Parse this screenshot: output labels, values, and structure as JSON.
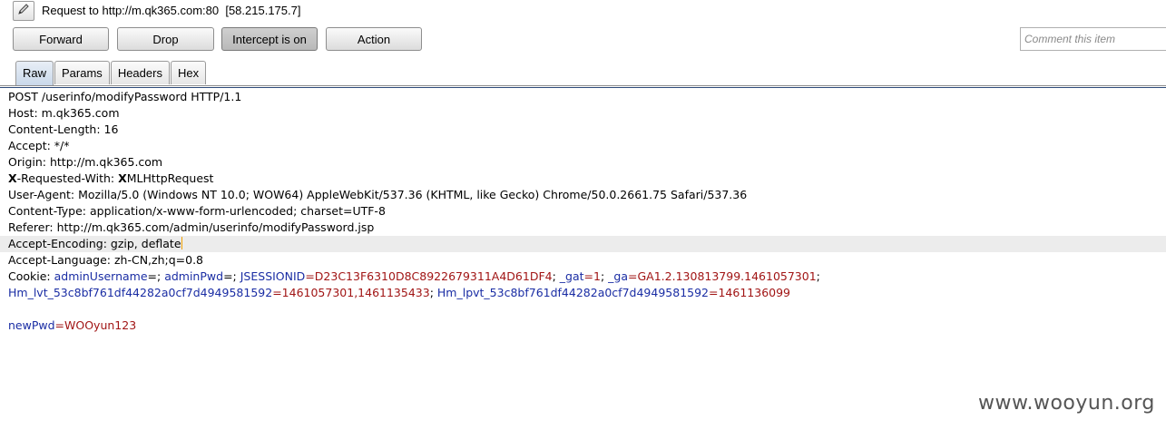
{
  "header": {
    "title": "Request to http://m.qk365.com:80  [58.215.175.7]",
    "icon": "pencil-icon"
  },
  "toolbar": {
    "forward_label": "Forward",
    "drop_label": "Drop",
    "intercept_label": "Intercept is on",
    "action_label": "Action",
    "comment_placeholder": "Comment this item"
  },
  "tabs": [
    {
      "label": "Raw",
      "active": true
    },
    {
      "label": "Params",
      "active": false
    },
    {
      "label": "Headers",
      "active": false
    },
    {
      "label": "Hex",
      "active": false
    }
  ],
  "request": {
    "request_line": "POST /userinfo/modifyPassword HTTP/1.1",
    "host": "Host: m.qk365.com",
    "content_length": "Content-Length: 16",
    "accept": "Accept: */*",
    "origin": "Origin: http://m.qk365.com",
    "xrw_bold1": "X",
    "xrw_mid": "-Requested-With: ",
    "xrw_bold2": "X",
    "xrw_rest": "MLHttpRequest",
    "user_agent": "User-Agent: Mozilla/5.0 (Windows NT 10.0; WOW64) AppleWebKit/537.36 (KHTML, like Gecko) Chrome/50.0.2661.75 Safari/537.36",
    "content_type": "Content-Type: application/x-www-form-urlencoded; charset=UTF-8",
    "referer": "Referer: http://m.qk365.com/admin/userinfo/modifyPassword.jsp",
    "accept_encoding": "Accept-Encoding: gzip, deflate",
    "accept_language": "Accept-Language: zh-CN,zh;q=0.8",
    "cookie": {
      "label": "Cookie: ",
      "k1": "adminUsername",
      "eq1": "=; ",
      "k2": "adminPwd",
      "eq2": "=; ",
      "k3": "JSESSIONID",
      "v3": "=D23C13F6310D8C8922679311A4D61DF4",
      "sep3": "; ",
      "k4": "_gat",
      "v4": "=1",
      "sep4": "; ",
      "k5": "_ga",
      "v5": "=GA1.2.130813799.1461057301",
      "sep5": ";",
      "k6": "Hm_lvt_53c8bf761df44282a0cf7d4949581592",
      "v6": "=1461057301,1461135433",
      "sep6": "; ",
      "k7": "Hm_lpvt_53c8bf761df44282a0cf7d4949581592",
      "v7": "=1461136099"
    },
    "body_key": "newPwd",
    "body_value": "=WOOyun123"
  },
  "watermark": "www.wooyun.org",
  "colors": {
    "param_name": "#1a2da4",
    "param_value": "#a11515",
    "highlight_line": "#ececec",
    "caret": "#f0a000"
  }
}
